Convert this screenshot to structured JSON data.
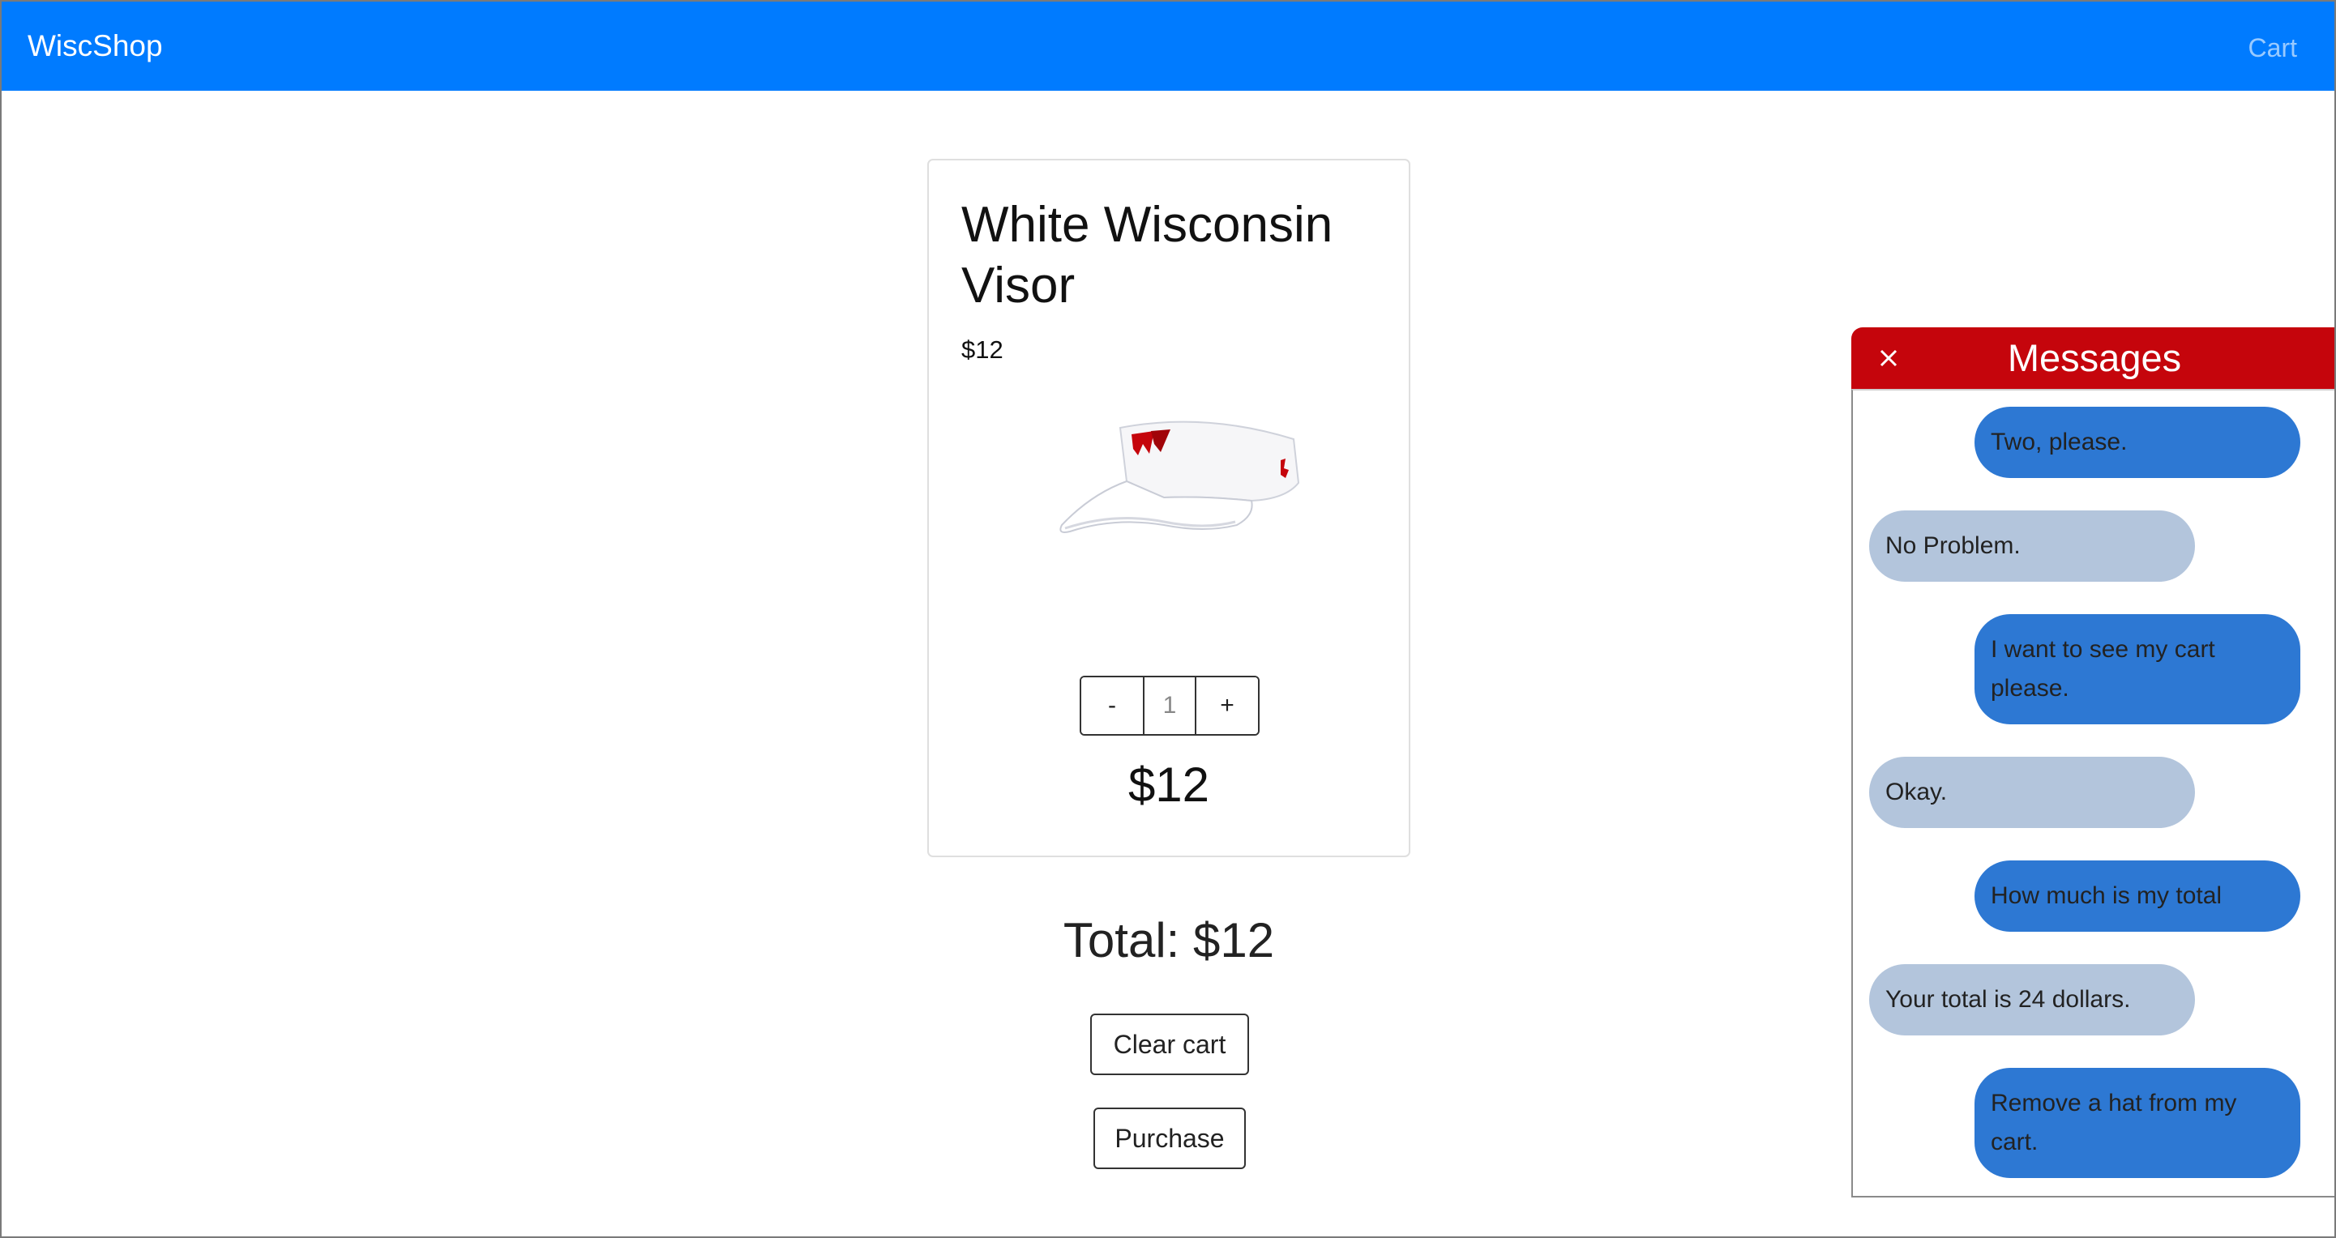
{
  "navbar": {
    "brand": "WiscShop",
    "cart_link": "Cart"
  },
  "product": {
    "title": "White Wisconsin Visor",
    "price": "$12",
    "quantity": "1",
    "decrement_label": "-",
    "increment_label": "+",
    "line_total": "$12"
  },
  "cart": {
    "total": "Total: $12",
    "clear_label": "Clear cart",
    "purchase_label": "Purchase"
  },
  "messages": {
    "title": "Messages",
    "items": [
      {
        "from": "user",
        "text": "Two, please."
      },
      {
        "from": "bot",
        "text": "No Problem."
      },
      {
        "from": "user",
        "text": "I want to see my cart please."
      },
      {
        "from": "bot",
        "text": "Okay."
      },
      {
        "from": "user",
        "text": "How much is my total"
      },
      {
        "from": "bot",
        "text": "Your total is 24 dollars."
      },
      {
        "from": "user",
        "text": "Remove a hat from my cart."
      }
    ]
  },
  "colors": {
    "navbar": "#007bff",
    "messages_header": "#c5050c",
    "user_bubble": "#2d78d3",
    "bot_bubble": "#b3c5dc"
  }
}
